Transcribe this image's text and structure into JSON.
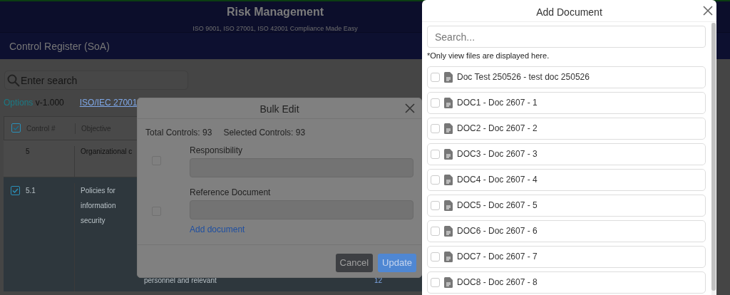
{
  "app_header": {
    "title": "Risk Management",
    "subtitle": "ISO 9001, ISO 27001, ISO 42001 Compliance Made Easy"
  },
  "page_title": "Control Register (SoA)",
  "search": {
    "placeholder": "Enter search"
  },
  "toolbar": {
    "options_link": "Options",
    "version": "v-1.000",
    "standard_link": "ISO/IEC 27001"
  },
  "table": {
    "select_all_checked": true,
    "columns": [
      "Control #",
      "Objective"
    ],
    "rows": [
      {
        "kind": "section",
        "control": "5",
        "objective": "Organizational c"
      },
      {
        "kind": "control",
        "checked": true,
        "control": "5.1",
        "objective": "Policies for information security",
        "column_3": "personnel and relevant",
        "column_4": "12"
      }
    ]
  },
  "bulk_edit": {
    "title": "Bulk Edit",
    "total": "Total Controls: 93",
    "selected": "Selected Controls: 93",
    "fields": [
      {
        "label": "Responsibility",
        "checked": false
      },
      {
        "label": "Reference Document",
        "checked": false,
        "link": "Add document"
      }
    ],
    "buttons": [
      {
        "label": "Cancel",
        "kind": "secondary"
      },
      {
        "label": "Update",
        "kind": "primary"
      }
    ]
  },
  "add_document": {
    "title": "Add Document",
    "search": {
      "placeholder": "Search..."
    },
    "note": "*Only view files are displayed here.",
    "documents": [
      {
        "label": "Doc Test 250526 - test doc 250526",
        "checked": false
      },
      {
        "label": "DOC1 - Doc 2607 - 1",
        "checked": false
      },
      {
        "label": "DOC2 - Doc 2607 - 2",
        "checked": false
      },
      {
        "label": "DOC3 - Doc 2607 - 3",
        "checked": false
      },
      {
        "label": "DOC4 - Doc 2607 - 4",
        "checked": false
      },
      {
        "label": "DOC5 - Doc 2607 - 5",
        "checked": false
      },
      {
        "label": "DOC6 - Doc 2607 - 6",
        "checked": false
      },
      {
        "label": "DOC7 - Doc 2607 - 7",
        "checked": false
      },
      {
        "label": "DOC8 - Doc 2607 - 8",
        "checked": false
      }
    ]
  }
}
